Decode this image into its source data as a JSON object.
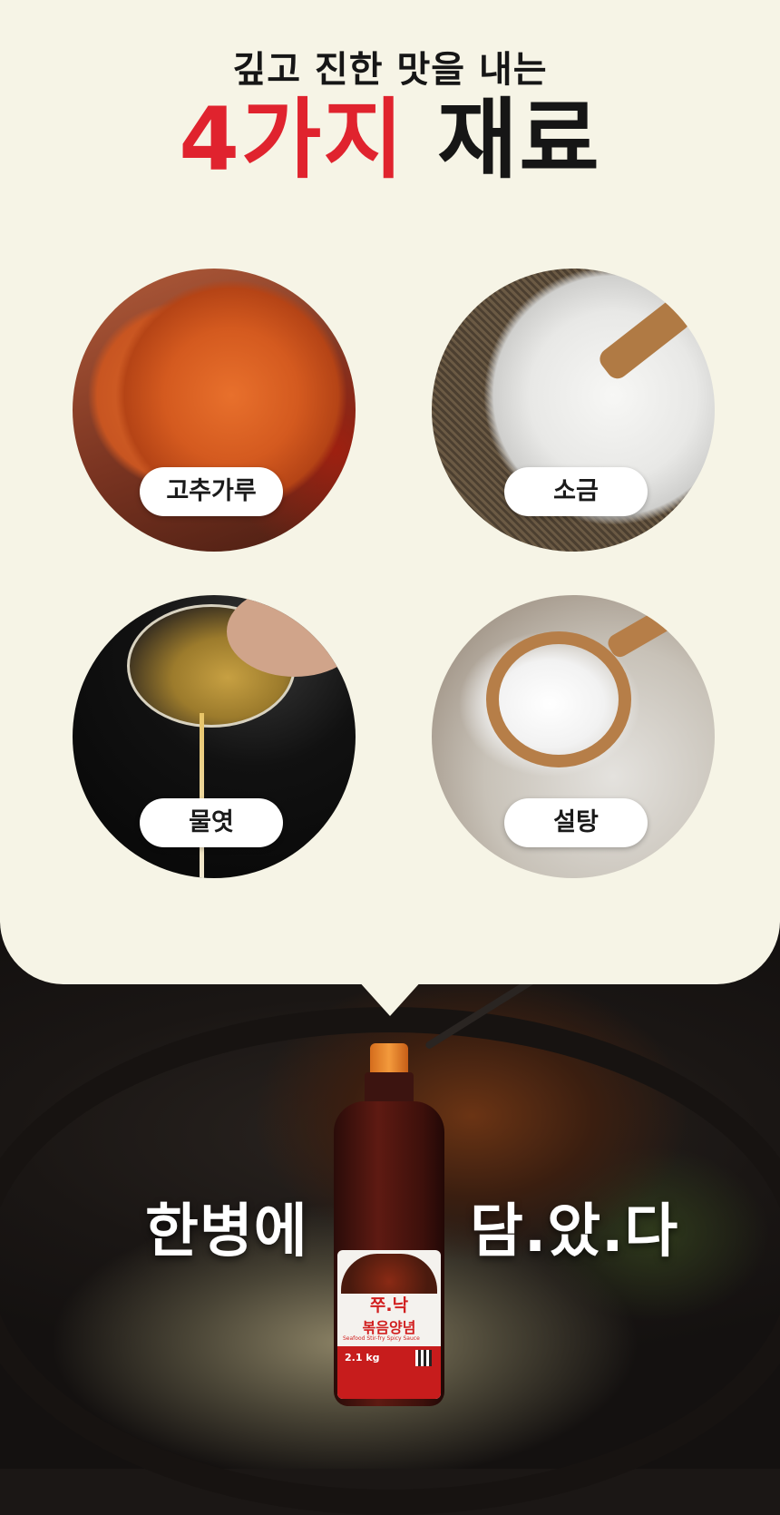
{
  "heading": {
    "line1": "깊고 진한 맛을 내는",
    "line2_highlight": "4가지",
    "line2_rest": "재료"
  },
  "ingredients": [
    {
      "label": "고추가루",
      "icon": "chili-powder-photo"
    },
    {
      "label": "소금",
      "icon": "salt-photo"
    },
    {
      "label": "물엿",
      "icon": "syrup-photo"
    },
    {
      "label": "설탕",
      "icon": "sugar-photo"
    }
  ],
  "tagline": {
    "left": "한병에",
    "right": "담.았.다"
  },
  "bottle": {
    "brand": "쭈.낙",
    "name": "볶음양념",
    "subtitle": "Seafood Stir-fry Spicy Sauce",
    "weight": "2.1 kg"
  },
  "colors": {
    "panel": "#f6f4e6",
    "accent_red": "#e0232e",
    "text_dark": "#161616"
  }
}
